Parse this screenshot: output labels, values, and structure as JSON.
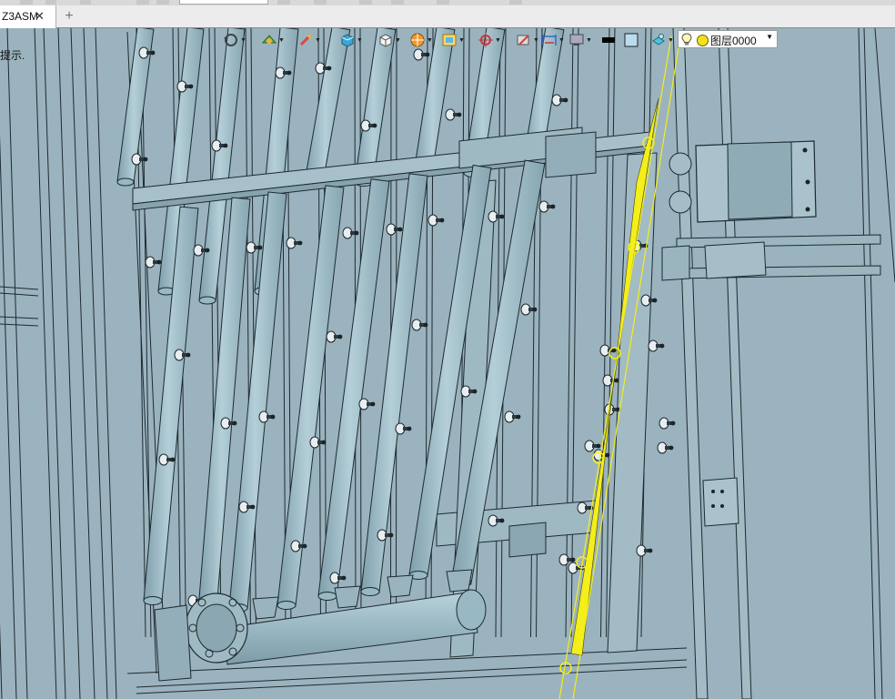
{
  "document_tab": {
    "label": "Z3ASM",
    "close_glyph": "✕"
  },
  "add_tab_glyph": "+",
  "status_hint": "提示.",
  "view_toolbar": {
    "icons": [
      "rotate-icon",
      "pan-icon",
      "zoom-icon",
      "shaded-cube-icon",
      "wireframe-cube-icon",
      "render-icon",
      "view-box-icon",
      "target-icon",
      "section-icon",
      "dimension-icon",
      "display-icon",
      "black-color-icon",
      "light-blue-color-icon",
      "appearance-icon"
    ],
    "dropdown_glyph": "▼"
  },
  "layer_selector": {
    "value": "图层0000",
    "dropdown_glyph": "▼"
  },
  "colors": {
    "background": "#9bb3be",
    "edge": "#1d2a30",
    "selection": "#f4ee1a",
    "pipe": "#98b8c3"
  }
}
